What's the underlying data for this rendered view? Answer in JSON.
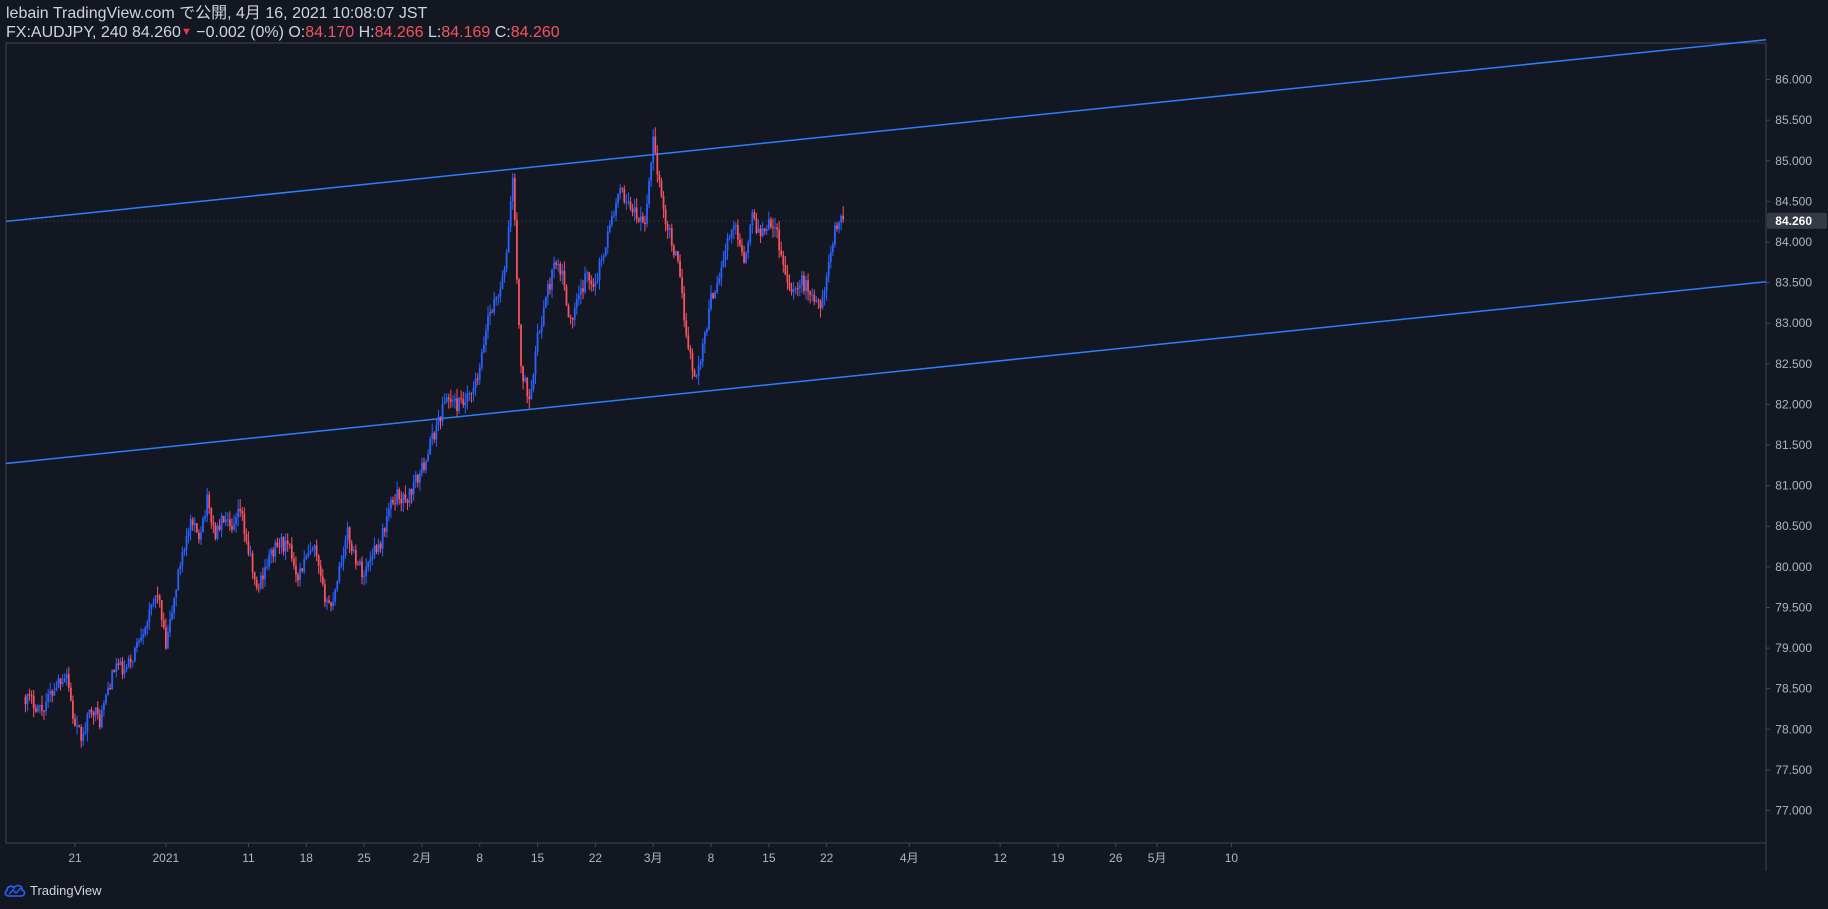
{
  "header": {
    "published_line": "lebain TradingView.com で公開, 4月 16, 2021 10:08:07 JST",
    "symbol": "FX:AUDJPY, 240",
    "last": "84.260",
    "change_arrow": "▼",
    "change": "−0.002 (0%)",
    "o_label": "O:",
    "o_value": "84.170",
    "h_label": "H:",
    "h_value": "84.266",
    "l_label": "L:",
    "l_value": "84.169",
    "c_label": "C:",
    "c_value": "84.260"
  },
  "brand": {
    "name": "TradingView",
    "icon": "tradingview-cloud-icon"
  },
  "colors": {
    "background": "#131722",
    "up": "#2962ff",
    "down": "#f7525f",
    "channel": "#2a7fff",
    "axis_text": "#b2b5be",
    "price_label_bg": "#363a45"
  },
  "chart_data": {
    "type": "candlestick",
    "symbol": "FX:AUDJPY",
    "interval": "240",
    "y_ticks": [
      "77.000",
      "77.500",
      "78.000",
      "78.500",
      "79.000",
      "79.500",
      "80.000",
      "80.500",
      "81.000",
      "81.500",
      "82.000",
      "82.500",
      "83.000",
      "83.500",
      "84.000",
      "84.500",
      "85.000",
      "85.500",
      "86.000"
    ],
    "ylim": [
      76.6,
      86.45
    ],
    "x_ticks": [
      {
        "label": "21",
        "day": 0
      },
      {
        "label": "2021",
        "day": 11
      },
      {
        "label": "11",
        "day": 21
      },
      {
        "label": "18",
        "day": 28
      },
      {
        "label": "25",
        "day": 35
      },
      {
        "label": "2月",
        "day": 42
      },
      {
        "label": "8",
        "day": 49
      },
      {
        "label": "15",
        "day": 56
      },
      {
        "label": "22",
        "day": 63
      },
      {
        "label": "3月",
        "day": 70
      },
      {
        "label": "8",
        "day": 77
      },
      {
        "label": "15",
        "day": 84
      },
      {
        "label": "22",
        "day": 91
      },
      {
        "label": "4月",
        "day": 101
      },
      {
        "label": "12",
        "day": 112
      },
      {
        "label": "19",
        "day": 119
      },
      {
        "label": "26",
        "day": 126
      },
      {
        "label": "5月",
        "day": 131
      },
      {
        "label": "10",
        "day": 140
      }
    ],
    "last_price": "84.260",
    "price_path": [
      [
        -6,
        78.4
      ],
      [
        -4,
        78.25
      ],
      [
        -2,
        78.6
      ],
      [
        -1,
        78.7
      ],
      [
        0,
        78.0
      ],
      [
        1,
        77.9
      ],
      [
        2,
        78.3
      ],
      [
        3,
        78.1
      ],
      [
        4,
        78.5
      ],
      [
        5,
        78.8
      ],
      [
        6,
        78.7
      ],
      [
        7,
        78.9
      ],
      [
        8,
        79.2
      ],
      [
        9,
        79.4
      ],
      [
        10,
        79.7
      ],
      [
        11,
        79.0
      ],
      [
        12,
        79.6
      ],
      [
        13,
        80.2
      ],
      [
        14,
        80.5
      ],
      [
        15,
        80.4
      ],
      [
        16,
        80.8
      ],
      [
        17,
        80.4
      ],
      [
        18,
        80.6
      ],
      [
        19,
        80.4
      ],
      [
        20,
        80.7
      ],
      [
        21,
        80.2
      ],
      [
        22,
        79.7
      ],
      [
        23,
        80.0
      ],
      [
        24,
        80.2
      ],
      [
        25,
        80.3
      ],
      [
        26,
        80.2
      ],
      [
        27,
        79.9
      ],
      [
        28,
        80.1
      ],
      [
        29,
        80.2
      ],
      [
        30,
        79.7
      ],
      [
        31,
        79.5
      ],
      [
        32,
        80.0
      ],
      [
        33,
        80.4
      ],
      [
        34,
        80.1
      ],
      [
        35,
        79.9
      ],
      [
        36,
        80.2
      ],
      [
        37,
        80.3
      ],
      [
        38,
        80.7
      ],
      [
        39,
        80.9
      ],
      [
        40,
        80.8
      ],
      [
        41,
        81.0
      ],
      [
        42,
        81.2
      ],
      [
        43,
        81.5
      ],
      [
        44,
        81.8
      ],
      [
        45,
        82.1
      ],
      [
        46,
        82.0
      ],
      [
        47,
        82.0
      ],
      [
        48,
        82.1
      ],
      [
        49,
        82.4
      ],
      [
        50,
        83.1
      ],
      [
        51,
        83.3
      ],
      [
        52,
        83.6
      ],
      [
        53,
        84.8
      ],
      [
        54,
        82.4
      ],
      [
        55,
        82.1
      ],
      [
        56,
        82.8
      ],
      [
        57,
        83.3
      ],
      [
        58,
        83.7
      ],
      [
        59,
        83.6
      ],
      [
        60,
        83.0
      ],
      [
        61,
        83.3
      ],
      [
        62,
        83.6
      ],
      [
        63,
        83.5
      ],
      [
        64,
        83.9
      ],
      [
        65,
        84.3
      ],
      [
        66,
        84.6
      ],
      [
        67,
        84.5
      ],
      [
        68,
        84.3
      ],
      [
        69,
        84.2
      ],
      [
        70,
        85.3
      ],
      [
        71,
        84.5
      ],
      [
        72,
        84.1
      ],
      [
        73,
        83.7
      ],
      [
        74,
        82.9
      ],
      [
        75,
        82.3
      ],
      [
        76,
        82.7
      ],
      [
        77,
        83.3
      ],
      [
        78,
        83.6
      ],
      [
        79,
        84.0
      ],
      [
        80,
        84.2
      ],
      [
        81,
        83.8
      ],
      [
        82,
        84.3
      ],
      [
        83,
        84.1
      ],
      [
        84,
        84.3
      ],
      [
        85,
        84.1
      ],
      [
        86,
        83.6
      ],
      [
        87,
        83.4
      ],
      [
        88,
        83.5
      ],
      [
        89,
        83.4
      ],
      [
        90,
        83.2
      ],
      [
        91,
        83.5
      ],
      [
        92,
        84.2
      ],
      [
        93,
        84.3
      ]
    ]
  }
}
